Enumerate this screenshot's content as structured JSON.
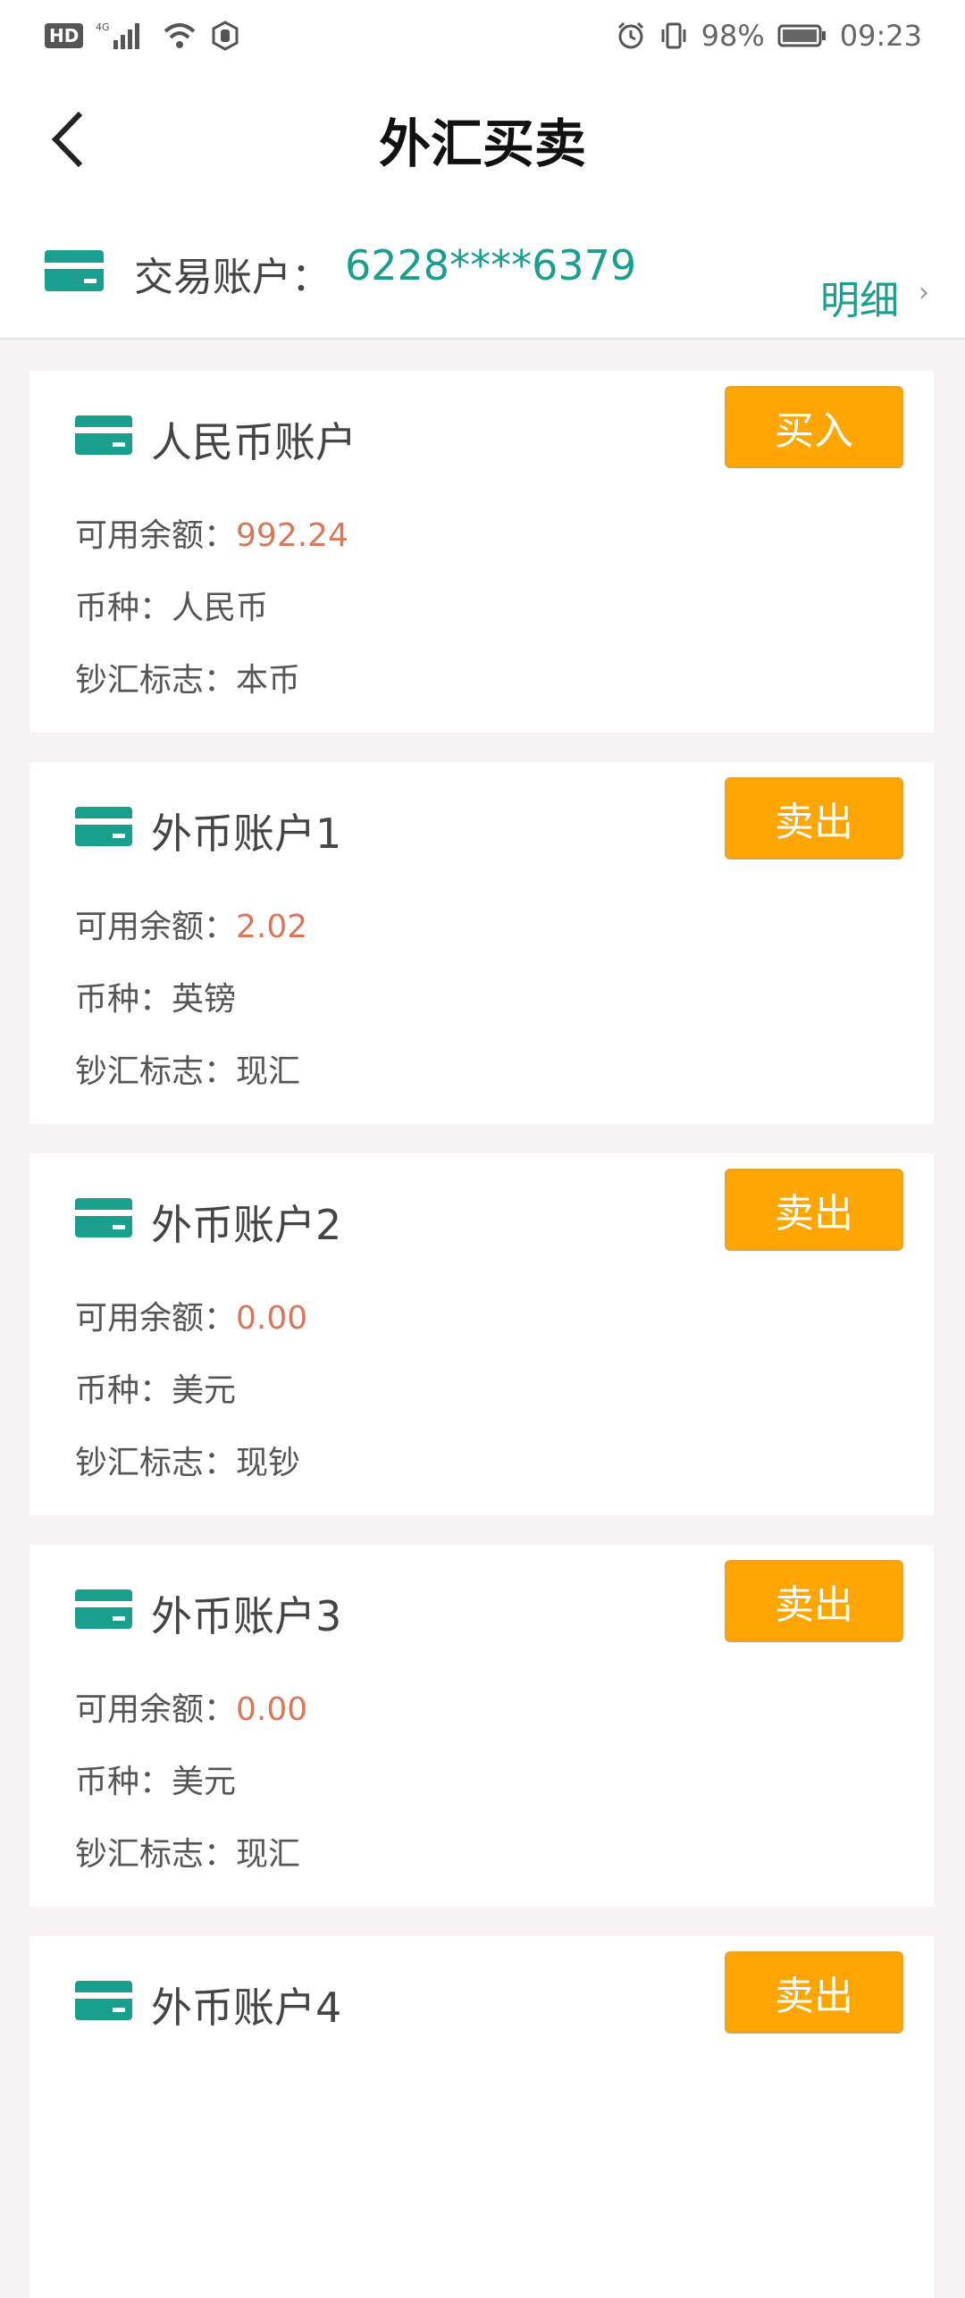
{
  "status": {
    "left_badge": "HD",
    "network": "4G",
    "battery": "98%",
    "time": "09:23"
  },
  "header": {
    "title": "外汇买卖"
  },
  "account": {
    "label": "交易账户：",
    "number": "6228****6379",
    "detail": "明细",
    "chevron": "›"
  },
  "cards": [
    {
      "title": "人民币账户",
      "button": "买入",
      "balance_label": "可用余额：",
      "balance": "992.24",
      "currency_label": "币种：",
      "currency": "人民币",
      "flag_label": "钞汇标志：",
      "flag": "本币"
    },
    {
      "title": "外币账户1",
      "button": "卖出",
      "balance_label": "可用余额：",
      "balance": "2.02",
      "currency_label": "币种：",
      "currency": "英镑",
      "flag_label": "钞汇标志：",
      "flag": "现汇"
    },
    {
      "title": "外币账户2",
      "button": "卖出",
      "balance_label": "可用余额：",
      "balance": "0.00",
      "currency_label": "币种：",
      "currency": "美元",
      "flag_label": "钞汇标志：",
      "flag": "现钞"
    },
    {
      "title": "外币账户3",
      "button": "卖出",
      "balance_label": "可用余额：",
      "balance": "0.00",
      "currency_label": "币种：",
      "currency": "美元",
      "flag_label": "钞汇标志：",
      "flag": "现汇"
    },
    {
      "title": "外币账户4",
      "button": "卖出"
    }
  ],
  "colors": {
    "accent_teal": "#1a9e8e",
    "button_orange": "#ffa500",
    "value_orange": "#d9775a"
  }
}
